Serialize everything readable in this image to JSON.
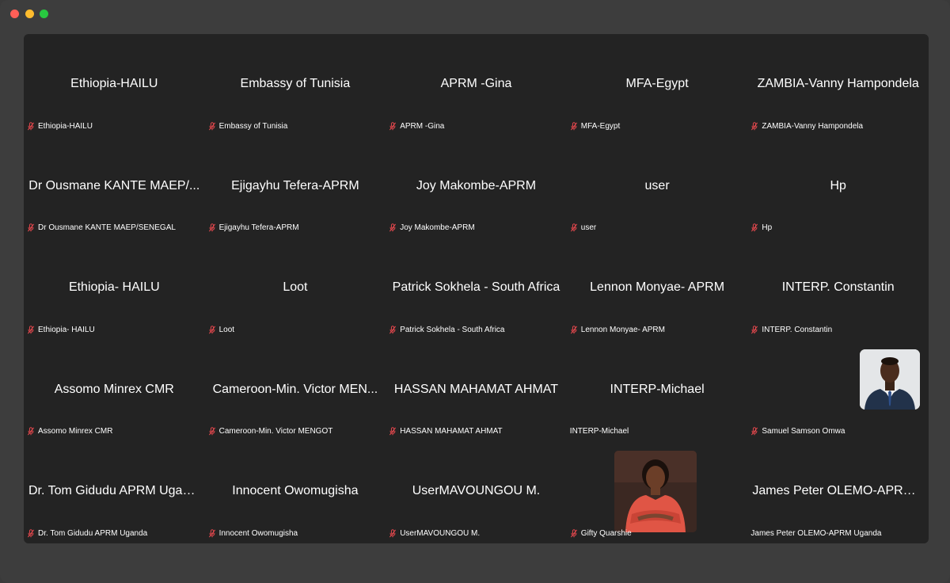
{
  "window": {
    "controls": [
      "close",
      "minimize",
      "zoom"
    ]
  },
  "colors": {
    "background": "#232323",
    "muted_mic": "#e0474c",
    "text": "#ffffff"
  },
  "participants": [
    {
      "display": "Ethiopia-HAILU",
      "label": "Ethiopia-HAILU",
      "muted": true
    },
    {
      "display": "Embassy of Tunisia",
      "label": "Embassy of Tunisia",
      "muted": true
    },
    {
      "display": "APRM -Gina",
      "label": "APRM -Gina",
      "muted": true
    },
    {
      "display": "MFA-Egypt",
      "label": "MFA-Egypt",
      "muted": true
    },
    {
      "display": "ZAMBIA-Vanny Hampondela",
      "label": "ZAMBIA-Vanny Hampondela",
      "muted": true
    },
    {
      "display": "Dr Ousmane KANTE MAEP/...",
      "label": "Dr Ousmane KANTE MAEP/SENEGAL",
      "muted": true
    },
    {
      "display": "Ejigayhu Tefera-APRM",
      "label": "Ejigayhu Tefera-APRM",
      "muted": true
    },
    {
      "display": "Joy Makombe-APRM",
      "label": "Joy Makombe-APRM",
      "muted": true
    },
    {
      "display": "user",
      "label": "user",
      "muted": true
    },
    {
      "display": "Hp",
      "label": "Hp",
      "muted": true
    },
    {
      "display": "Ethiopia- HAILU",
      "label": "Ethiopia- HAILU",
      "muted": true
    },
    {
      "display": "Loot",
      "label": "Loot",
      "muted": true
    },
    {
      "display": "Patrick Sokhela - South Africa",
      "label": "Patrick Sokhela - South Africa",
      "muted": true
    },
    {
      "display": "Lennon Monyae- APRM",
      "label": "Lennon Monyae- APRM",
      "muted": true
    },
    {
      "display": "INTERP. Constantin",
      "label": "INTERP. Constantin",
      "muted": true
    },
    {
      "display": "Assomo Minrex CMR",
      "label": "Assomo Minrex CMR",
      "muted": true
    },
    {
      "display": "Cameroon-Min. Victor MEN...",
      "label": "Cameroon-Min. Victor MENGOT",
      "muted": true
    },
    {
      "display": "HASSAN MAHAMAT AHMAT",
      "label": "HASSAN MAHAMAT AHMAT",
      "muted": true
    },
    {
      "display": "INTERP-Michael",
      "label": "INTERP-Michael",
      "muted": false
    },
    {
      "display": "",
      "label": "Samuel Samson Omwa",
      "muted": true,
      "avatar": "samuel"
    },
    {
      "display": "Dr. Tom Gidudu APRM Ugan...",
      "label": "Dr. Tom Gidudu APRM Uganda",
      "muted": true
    },
    {
      "display": "Innocent Owomugisha",
      "label": "Innocent Owomugisha",
      "muted": true
    },
    {
      "display": "UserMAVOUNGOU M.",
      "label": "UserMAVOUNGOU M.",
      "muted": true
    },
    {
      "display": "",
      "label": "Gifty Quarshie",
      "muted": true,
      "avatar": "gifty"
    },
    {
      "display": "James Peter OLEMO-APRM...",
      "label": "James Peter OLEMO-APRM Uganda",
      "muted": false
    }
  ]
}
